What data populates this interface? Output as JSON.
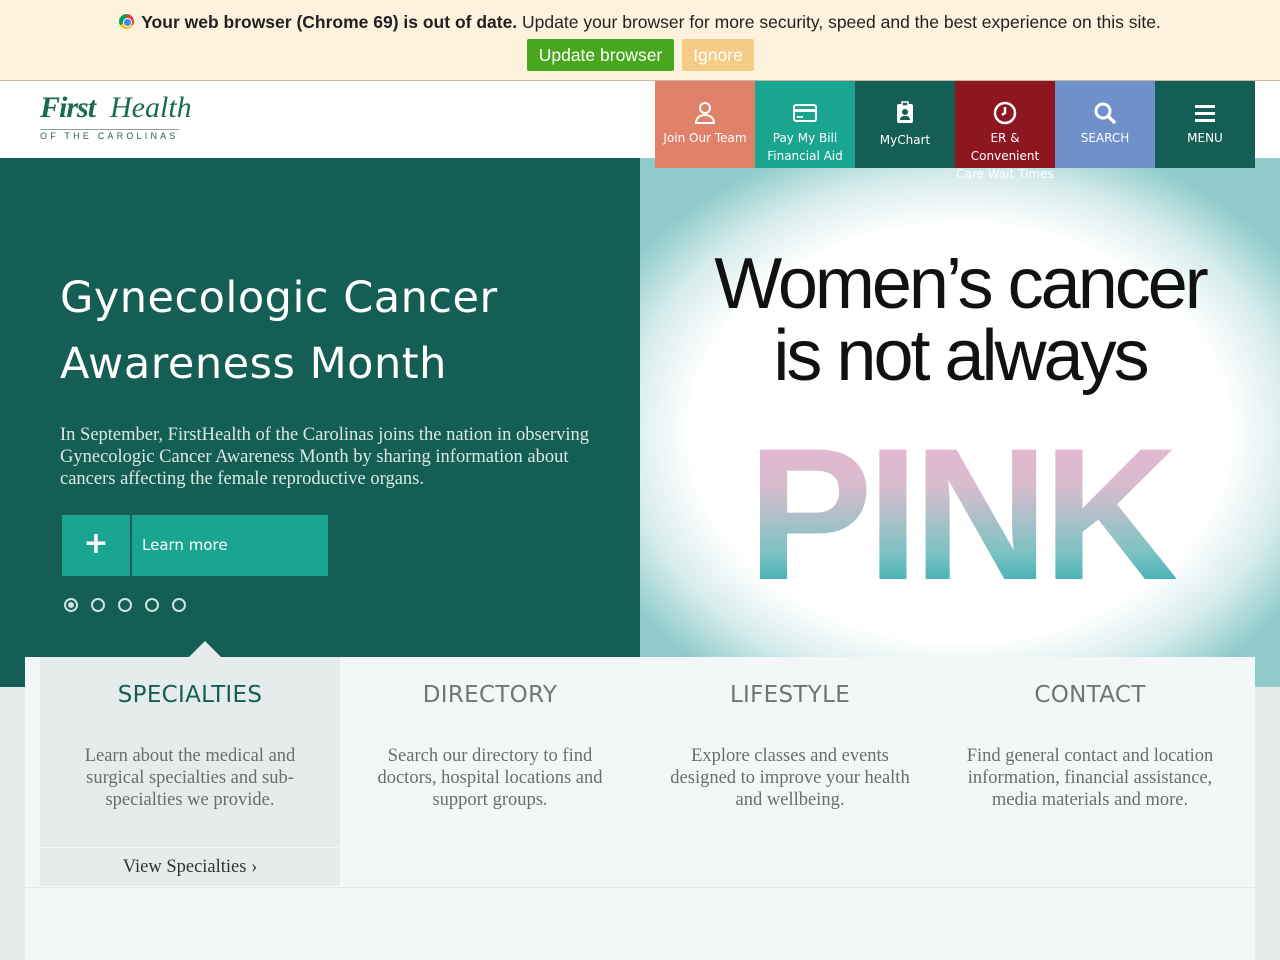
{
  "update_banner": {
    "bold_text": "Your web browser (Chrome 69) is out of date.",
    "text": " Update your browser for more security, speed and the best experience on this site.",
    "update_label": "Update browser",
    "ignore_label": "Ignore"
  },
  "logo": {
    "first": "First",
    "health": "Health",
    "tagline": "OF THE CAROLINAS"
  },
  "topnav": {
    "items": [
      {
        "label": "Join Our Team",
        "color": "#e0826a",
        "icon": "user-icon"
      },
      {
        "label": "Pay My Bill Financial Aid",
        "color": "#1aa591",
        "icon": "credit-card-icon"
      },
      {
        "label": "MyChart",
        "color": "#145e55",
        "icon": "badge-icon"
      },
      {
        "label": "ER & Convenient Care Wait Times",
        "color": "#8d1620",
        "icon": "clock-icon"
      },
      {
        "label": "SEARCH",
        "color": "#6f90c8",
        "icon": "search-icon"
      },
      {
        "label": "MENU",
        "color": "#145e55",
        "icon": "menu-icon"
      }
    ]
  },
  "hero": {
    "title": "Gynecologic Cancer Awareness Month",
    "text": "In September, FirstHealth of the Carolinas joins the nation in observing Gynecologic Cancer Awareness Month by sharing information about cancers affecting the female reproductive organs.",
    "button_label": "Learn more",
    "image_line1": "Women’s cancer",
    "image_line2": "is not always",
    "image_word": "PINK"
  },
  "panels": [
    {
      "title": "SPECIALTIES",
      "desc": "Learn about the medical and surgical specialties and sub-specialties we provide.",
      "link": "View Specialties ›"
    },
    {
      "title": "DIRECTORY",
      "desc": "Search our directory to find doctors, hospital locations and support groups."
    },
    {
      "title": "LIFESTYLE",
      "desc": "Explore classes and events designed to improve your health and wellbeing."
    },
    {
      "title": "CONTACT",
      "desc": "Find general contact and location information, financial assistance, media materials and more."
    }
  ]
}
